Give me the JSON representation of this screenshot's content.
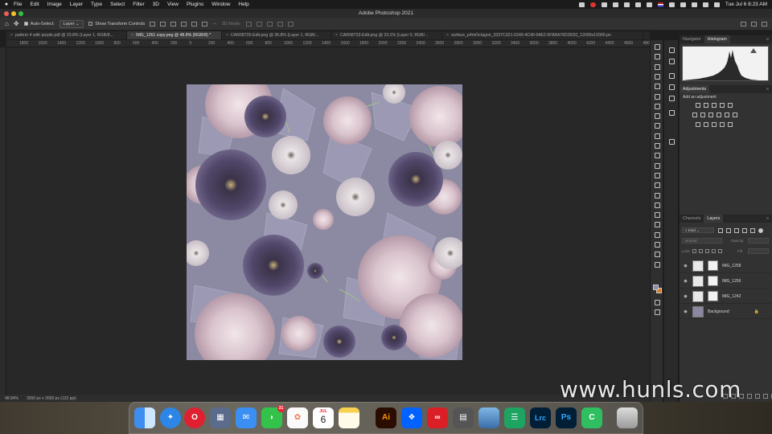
{
  "menubar": {
    "app": "Photoshop",
    "items": [
      "File",
      "Edit",
      "Image",
      "Layer",
      "Type",
      "Select",
      "Filter",
      "3D",
      "View",
      "Plugins",
      "Window",
      "Help"
    ],
    "clock": "Tue Jul 6  8:23 AM"
  },
  "window": {
    "title": "Adobe Photoshop 2021"
  },
  "options": {
    "auto_select_label": "Auto-Select:",
    "auto_select_value": "Layer",
    "transform_label": "Show Transform Controls",
    "mode_3d": "3D Mode:"
  },
  "tabs": [
    "pattern 4 with purple.pdf @ 23.8% (Layer 1, RGB/8...",
    "IMG_1261 copy.png @ 48.8% (RGB/8) *",
    "CAR08725-Edit.png @ 36.8% (Layer 1, RGB/...",
    "CAR08733-Edit.png @ 23.1% (Layer 0, RGB/...",
    "surface_p4mOctagon_3337C321-0249-4C40-94E2-5F8AA76D35D0_12000x12000.pn"
  ],
  "active_tab": 1,
  "ruler_top": [
    "1800",
    "1600",
    "1400",
    "1200",
    "1000",
    "800",
    "600",
    "400",
    "200",
    "0",
    "200",
    "400",
    "600",
    "800",
    "1000",
    "1200",
    "1400",
    "1600",
    "1800",
    "2000",
    "2200",
    "2400",
    "2600",
    "2800",
    "3000",
    "3200",
    "3400",
    "3600",
    "3800",
    "4000",
    "4200",
    "4400",
    "4600",
    "4800"
  ],
  "status": {
    "zoom": "48.84%",
    "doc_info": "3000 px x 3000 px (132 ppi)"
  },
  "panels": {
    "top_tabs": [
      "Navigator",
      "Histogram"
    ],
    "top_active": 1,
    "adjust_title": "Adjustments",
    "adjust_hint": "Add an adjustment",
    "layer_tabs": [
      "Channels",
      "Layers"
    ],
    "layer_active": 1,
    "kind_label": "Kind",
    "blend_mode": "Normal",
    "opacity_label": "Opacity:",
    "lock_label": "Lock:",
    "fill_label": "Fill:",
    "layers": [
      {
        "name": "IMG_1258",
        "mask": true
      },
      {
        "name": "IMG_1256",
        "mask": true
      },
      {
        "name": "IMG_1242",
        "mask": true
      },
      {
        "name": "Background",
        "mask": false
      }
    ]
  },
  "dock": {
    "apps": [
      "finder",
      "safari",
      "opera",
      "launchpad",
      "mail",
      "messages",
      "photos",
      "calendar",
      "notes",
      "illustrator",
      "dropbox",
      "creative-cloud",
      "calculator",
      "preview",
      "sheets",
      "lightroom-classic",
      "photoshop",
      "camo",
      "trash"
    ],
    "messages_badge": "21",
    "calendar_month": "JUL",
    "calendar_day": "6",
    "illustrator_label": "Ai",
    "lightroom_label": "Lrc",
    "photoshop_label": "Ps"
  },
  "watermark": "www.hunls.com"
}
